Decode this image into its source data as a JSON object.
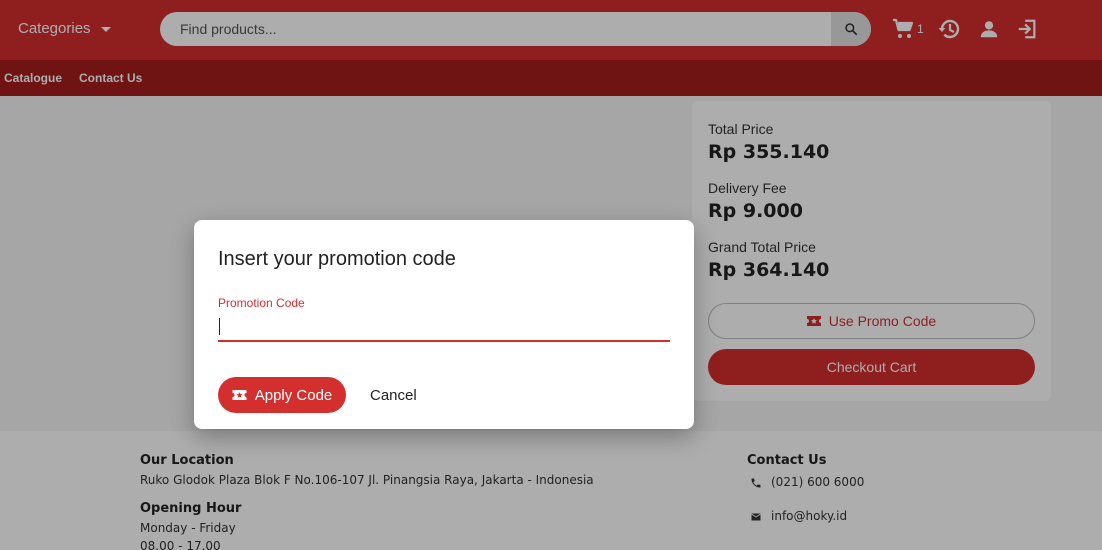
{
  "header": {
    "categories_label": "Categories",
    "search_placeholder": "Find products...",
    "cart_count": "1"
  },
  "subnav": {
    "items": [
      "Catalogue",
      "Contact Us"
    ]
  },
  "summary": {
    "total_label": "Total Price",
    "total_value": "Rp 355.140",
    "delivery_label": "Delivery Fee",
    "delivery_value": "Rp 9.000",
    "grand_label": "Grand Total Price",
    "grand_value": "Rp 364.140",
    "promo_button": "Use Promo Code",
    "checkout_button": "Checkout Cart"
  },
  "footer": {
    "location_heading": "Our Location",
    "location_text": "Ruko Glodok Plaza Blok F No.106-107 Jl. Pinangsia Raya, Jakarta - Indonesia",
    "hours_heading": "Opening Hour",
    "hours_days": "Monday - Friday",
    "hours_time": "08.00 - 17.00",
    "contact_heading": "Contact Us",
    "phone": "(021) 600 6000",
    "email": "info@hoky.id"
  },
  "dialog": {
    "title": "Insert your promotion code",
    "field_label": "Promotion Code",
    "field_value": "",
    "apply_button": "Apply Code",
    "cancel_button": "Cancel"
  },
  "colors": {
    "brand": "#d32f2f",
    "brand_dark": "#a51c1c"
  }
}
